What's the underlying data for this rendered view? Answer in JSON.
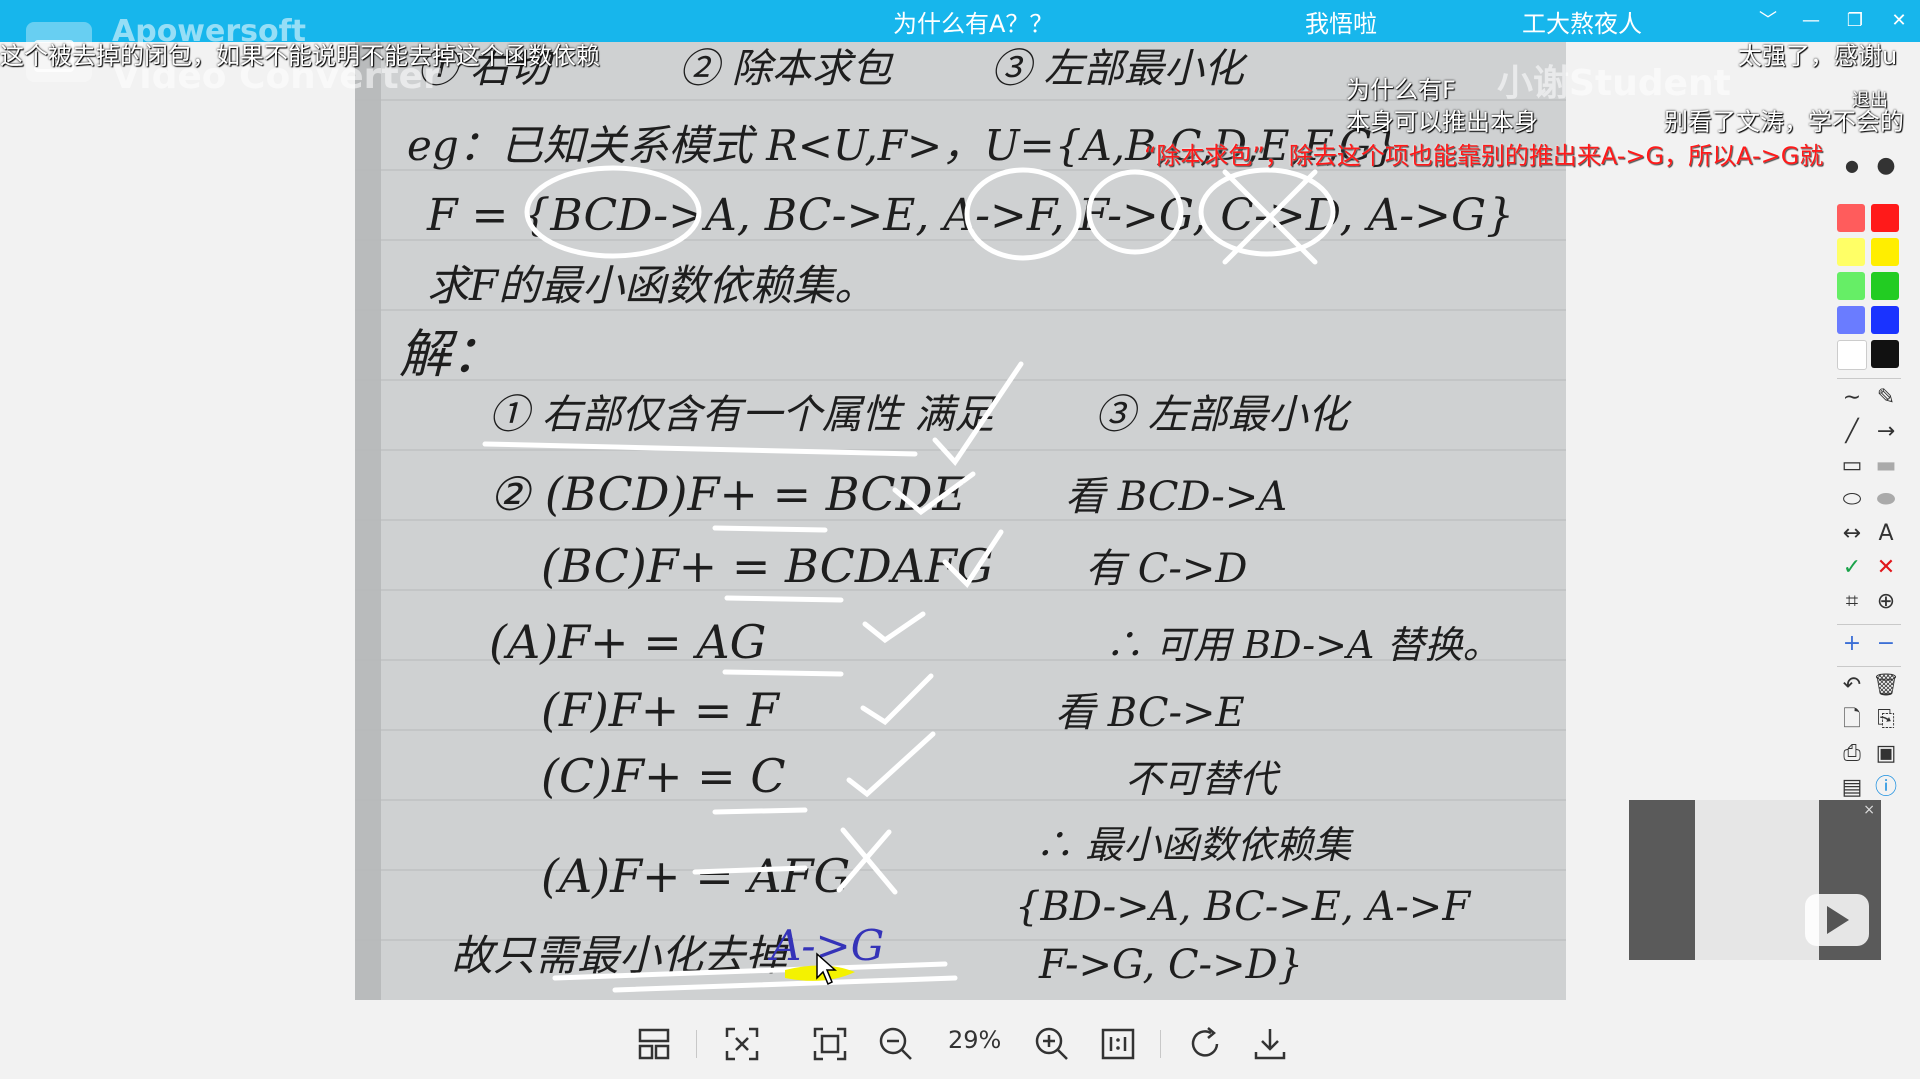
{
  "titlebar": {
    "items": [
      "为什么有A？？",
      "我悟啦",
      "工大熬夜人"
    ],
    "controls": [
      "﹀",
      "—",
      "❐",
      "✕"
    ]
  },
  "watermark": {
    "brand": "Apowersoft",
    "product": "Video Converter",
    "uploader": "小谢Student"
  },
  "danmaku": [
    {
      "text": "这个被去掉的闭包，如果不能说明不能去掉这个函数依赖",
      "color": "white"
    },
    {
      "text": "为什么有F",
      "color": "white"
    },
    {
      "text": "本身可以推出本身",
      "color": "white"
    },
    {
      "text": "太强了，感谢u",
      "color": "white"
    },
    {
      "text": "别看了文涛，学不会的",
      "color": "white"
    },
    {
      "text": "“除本求包”，除去这个项也能靠别的推出来A->G，所以A->G就",
      "color": "red"
    },
    {
      "text": "退出",
      "color": "white"
    }
  ],
  "notes": {
    "header": [
      "① 右切",
      "② 除本求包",
      "③ 左部最小化"
    ],
    "eg_line": "eg：已知关系模式 R<U,F>，U={A,B,C,D,E,F,G}",
    "f_line": "F = {BCD->A, BC->E, A->F, F->G, C->D, A->G}",
    "question": "求F的最小函数依赖集。",
    "solution": "解：",
    "step1": "① 右部仅含有一个属性 满足",
    "closures": [
      "② (BCD)F+ = BCDE",
      "(BC)F+ = BCDAFG",
      "(A)F+ = AG",
      "(F)F+ = F",
      "(C)F+ = C",
      "(A)F+ = AFG"
    ],
    "conclusion": "故只需最小化去掉",
    "removed_dep": "A->G",
    "step3": "③ 左部最小化",
    "right_notes": [
      "看 BCD->A",
      "有 C->D",
      "∴ 可用 BD->A 替换。",
      "看 BC->E",
      "不可替代",
      "∴ 最小函数依赖集"
    ],
    "result_set_1": "{BD->A, BC->E, A->F",
    "result_set_2": "F->G, C->D}"
  },
  "bottom_bar": {
    "zoom": "29%",
    "buttons": [
      "layout",
      "fit-screen",
      "actual-frame",
      "zoom-out",
      "zoom-in",
      "one-to-one",
      "rotate",
      "download"
    ]
  },
  "toolbar_colors": [
    "#ff5c5c",
    "#ff1a1a",
    "#ffff66",
    "#ffee00",
    "#66ee66",
    "#22cc22",
    "#6a7cff",
    "#1a33ff",
    "#ffffff",
    "#111111"
  ]
}
